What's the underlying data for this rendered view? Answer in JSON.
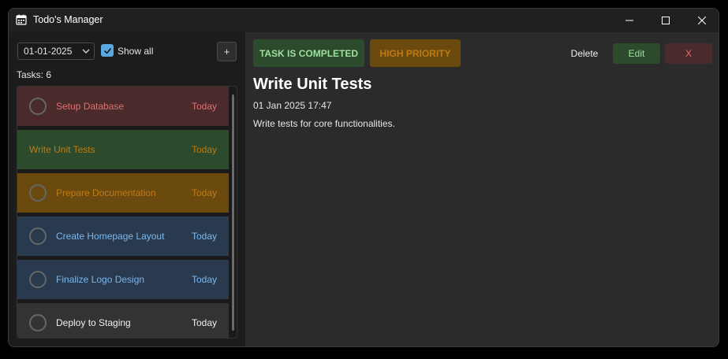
{
  "window": {
    "title": "Todo's Manager"
  },
  "toolbar": {
    "date_value": "01-01-2025",
    "show_all_label": "Show all",
    "show_all_checked": true,
    "add_label": "+"
  },
  "tasks_label": "Tasks: 6",
  "tasks": [
    {
      "title": "Setup Database",
      "due": "Today",
      "bg": "#4a2a2a",
      "color": "#e07070",
      "checkbox": true
    },
    {
      "title": "Write Unit Tests",
      "due": "Today",
      "bg": "#2c4a2c",
      "color": "#c07a12",
      "checkbox": false
    },
    {
      "title": "Prepare Documentation",
      "due": "Today",
      "bg": "#6b4a10",
      "color": "#c07a12",
      "checkbox": true
    },
    {
      "title": "Create Homepage Layout",
      "due": "Today",
      "bg": "#2a3a4e",
      "color": "#7ab8f0",
      "checkbox": true
    },
    {
      "title": "Finalize Logo Design",
      "due": "Today",
      "bg": "#2a3a4e",
      "color": "#7ab8f0",
      "checkbox": true
    },
    {
      "title": "Deploy to Staging",
      "due": "Today",
      "bg": "#333333",
      "color": "#f0f0f0",
      "checkbox": true
    }
  ],
  "detail": {
    "status_badge": "TASK IS COMPLETED",
    "priority_badge": "HIGH PRIORITY",
    "delete_label": "Delete",
    "edit_label": "Edit",
    "close_label": "X",
    "title": "Write Unit Tests",
    "datetime": "01 Jan 2025 17:47",
    "description": "Write tests for core functionalities."
  }
}
